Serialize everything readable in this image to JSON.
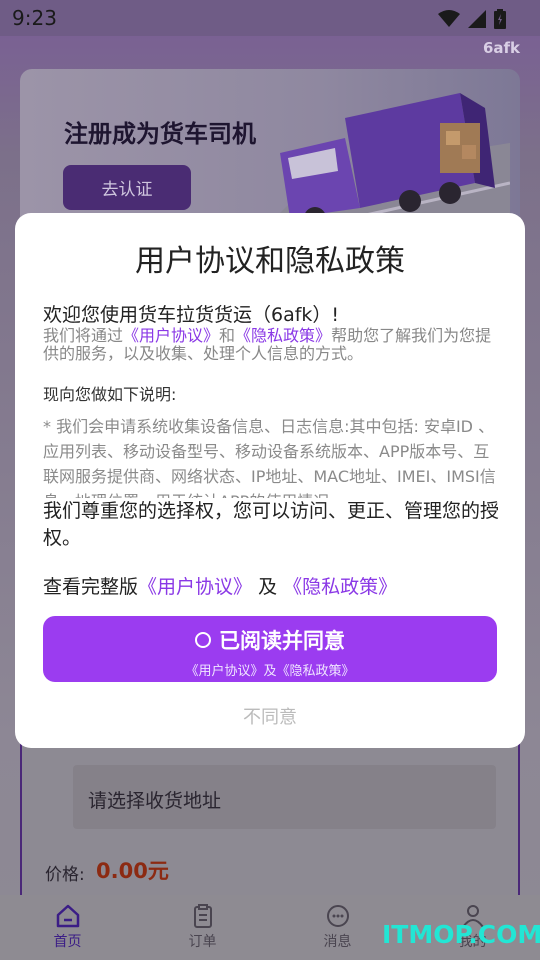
{
  "status_bar": {
    "time": "9:23"
  },
  "app_tag": "6afk",
  "banner": {
    "title": "注册成为货车司机",
    "button_label": "去认证"
  },
  "form": {
    "address_placeholder": "请选择收货地址",
    "price_label": "价格:",
    "price_value": "0.00元"
  },
  "tabs": [
    {
      "label": "首页",
      "icon": "home-icon",
      "active": true
    },
    {
      "label": "订单",
      "icon": "clipboard-icon",
      "active": false
    },
    {
      "label": "消息",
      "icon": "message-icon",
      "active": false
    },
    {
      "label": "我的",
      "icon": "user-icon",
      "active": false
    }
  ],
  "watermark": "ITMOP.COM",
  "modal": {
    "title": "用户协议和隐私政策",
    "welcome": "欢迎您使用货车拉货货运（6afk）!",
    "intro_prefix": "我们将通过",
    "user_agreement_link": "《用户协议》",
    "intro_and": "和",
    "privacy_link": "《隐私政策》",
    "intro_suffix": "帮助您了解我们为您提供的服务，以及收集、处理个人信息的方式。",
    "note_title": "现向您做如下说明:",
    "scroll_text": "* 我们会申请系统收集设备信息、日志信息:其中包括: 安卓ID 、应用列表、移动设备型号、移动设备系统版本、APP版本号、互联网服务提供商、网络状态、IP地址、MAC地址、IMEI、IMSI信息、地理位置，用于统计APP的使用情况",
    "respect_text": "我们尊重您的选择权，您可以访问、更正、管理您的授权。",
    "full_prefix": "查看完整版",
    "full_user_link": "《用户协议》",
    "full_and": "及",
    "full_privacy_link": "《隐私政策》",
    "agree_label": "已阅读并同意",
    "agree_sub": "《用户协议》及《隐私政策》",
    "disagree_label": "不同意"
  },
  "colors": {
    "accent": "#9b3cf0",
    "link": "#8a38e6",
    "price": "#8c2a12",
    "watermark": "#22e6d4"
  }
}
